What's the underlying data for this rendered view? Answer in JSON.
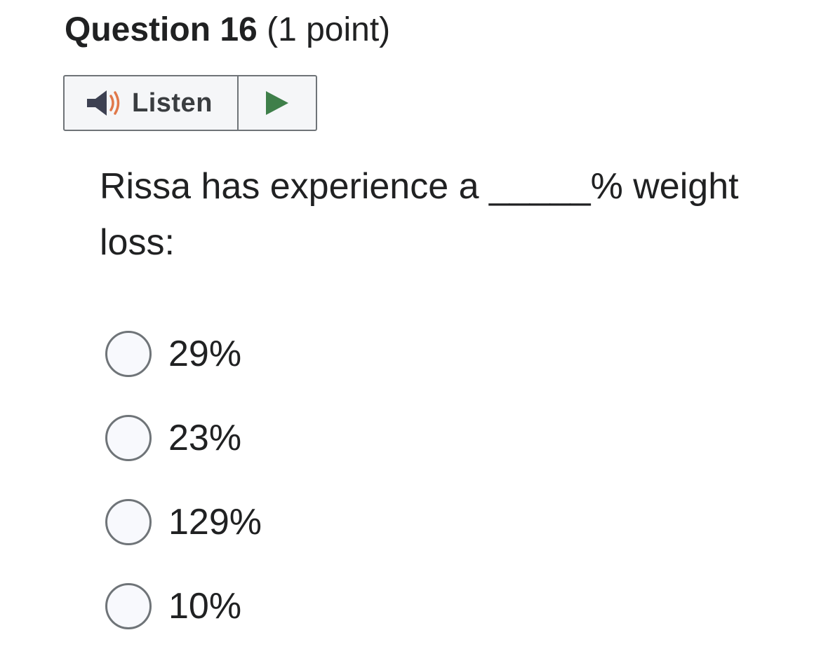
{
  "question": {
    "number_label": "Question 16",
    "points_label": "(1 point)",
    "text": "Rissa has experience a _____% weight loss:"
  },
  "listen": {
    "label": "Listen",
    "speaker_icon": "speaker-icon",
    "play_icon": "play-icon",
    "colors": {
      "speaker_body": "#3d4152",
      "sound_waves": "#e0784a",
      "play": "#3f7f4a"
    }
  },
  "choices": [
    {
      "label": "29%",
      "selected": false
    },
    {
      "label": "23%",
      "selected": false
    },
    {
      "label": "129%",
      "selected": false
    },
    {
      "label": "10%",
      "selected": false
    }
  ]
}
